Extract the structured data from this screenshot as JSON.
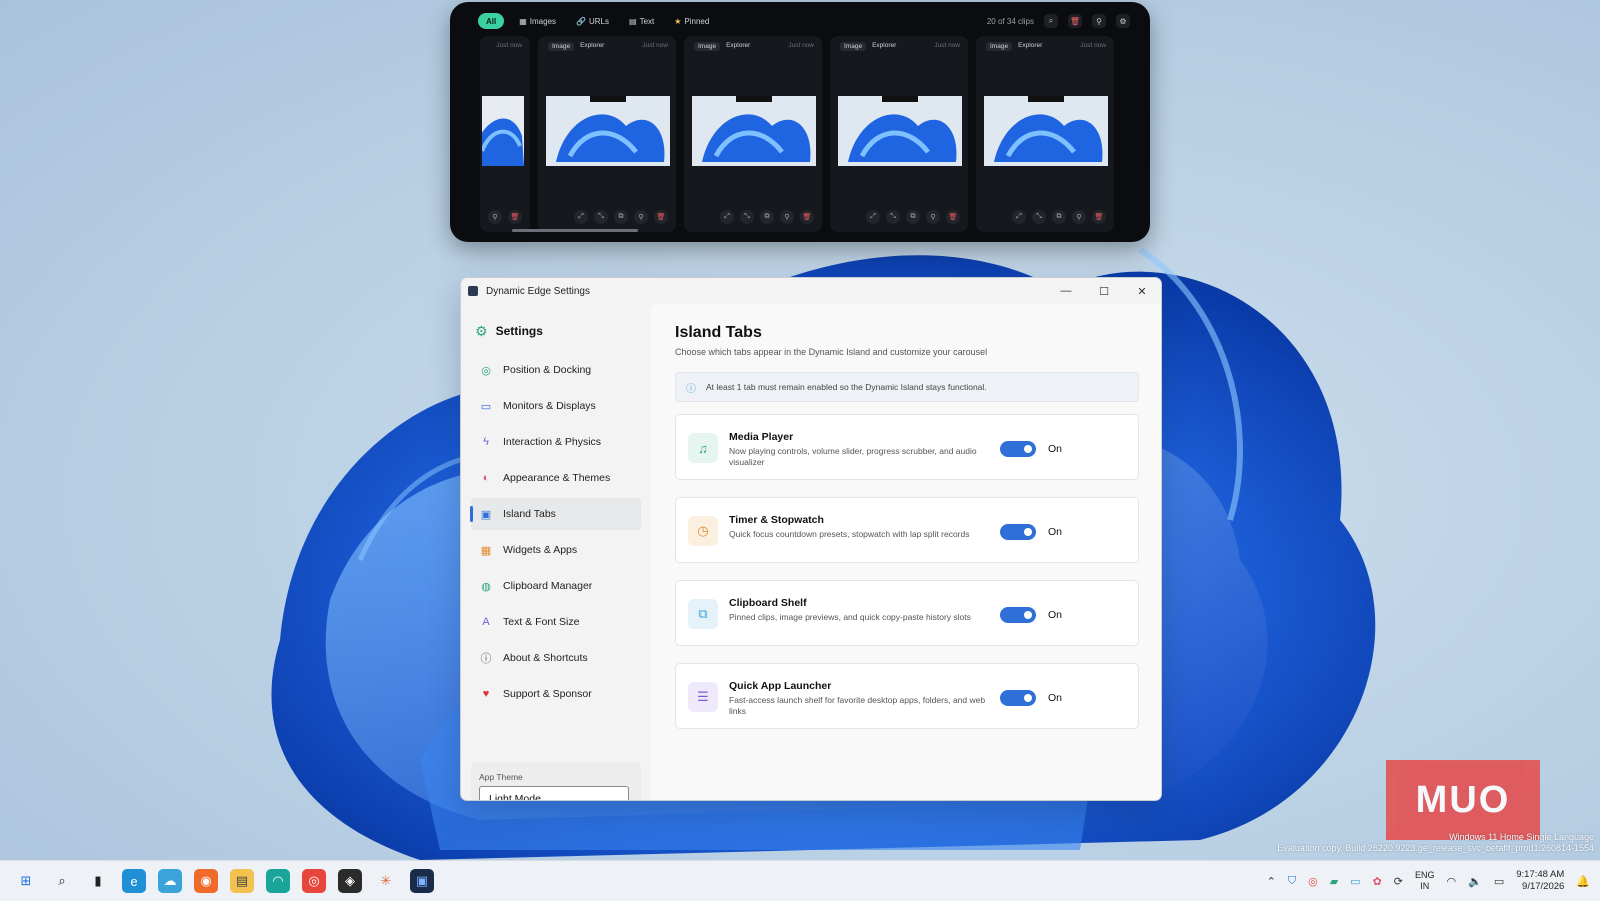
{
  "island": {
    "filters": [
      {
        "label": "All",
        "icon": "",
        "active": true
      },
      {
        "label": "Images",
        "icon": "▦",
        "active": false
      },
      {
        "label": "URLs",
        "icon": "🔗",
        "active": false
      },
      {
        "label": "Text",
        "icon": "▤",
        "active": false
      },
      {
        "label": "Pinned",
        "icon": "★",
        "active": false
      }
    ],
    "clip_count": "20 of 34 clips",
    "cards": [
      {
        "tag": "Image",
        "source": "Explorer",
        "time": "Just now"
      },
      {
        "tag": "Image",
        "source": "Explorer",
        "time": "Just now"
      },
      {
        "tag": "Image",
        "source": "Explorer",
        "time": "Just now"
      },
      {
        "tag": "Image",
        "source": "Explorer",
        "time": "Just now"
      }
    ],
    "partial_time": "Just now"
  },
  "window": {
    "title": "Dynamic Edge Settings",
    "controls": {
      "minimize": "—",
      "maximize": "☐",
      "close": "✕"
    }
  },
  "sidebar": {
    "title": "Settings",
    "items": [
      {
        "label": "Position & Docking",
        "icon": "◎",
        "color": "#2ba57a"
      },
      {
        "label": "Monitors & Displays",
        "icon": "▭",
        "color": "#2f6fd8"
      },
      {
        "label": "Interaction & Physics",
        "icon": "ϟ",
        "color": "#7b5cd6"
      },
      {
        "label": "Appearance & Themes",
        "icon": "◐",
        "color": "#e0556a"
      },
      {
        "label": "Island Tabs",
        "icon": "▣",
        "color": "#2f6fd8"
      },
      {
        "label": "Widgets & Apps",
        "icon": "▦",
        "color": "#e08a2b"
      },
      {
        "label": "Clipboard Manager",
        "icon": "◍",
        "color": "#2ba57a"
      },
      {
        "label": "Text & Font Size",
        "icon": "A",
        "color": "#7b5cd6"
      },
      {
        "label": "About & Shortcuts",
        "icon": "ⓘ",
        "color": "#555555"
      },
      {
        "label": "Support & Sponsor",
        "icon": "♥",
        "color": "#e0333f"
      }
    ],
    "active_index": 4,
    "theme": {
      "label": "App Theme",
      "value": "Light Mode"
    }
  },
  "main": {
    "title": "Island Tabs",
    "subtitle": "Choose which tabs appear in the Dynamic Island and customize your carousel",
    "info": "At least 1 tab must remain enabled so the Dynamic Island stays functional.",
    "tabs": [
      {
        "name": "Media Player",
        "desc": "Now playing controls, volume slider, progress scrubber, and audio visualizer",
        "state": "On",
        "icon": "♫",
        "icon_color": "#2ba57a",
        "icon_bg": "#e6f5ef"
      },
      {
        "name": "Timer & Stopwatch",
        "desc": "Quick focus countdown presets, stopwatch with lap split records",
        "state": "On",
        "icon": "◷",
        "icon_color": "#e08a2b",
        "icon_bg": "#fbefe0"
      },
      {
        "name": "Clipboard Shelf",
        "desc": "Pinned clips, image previews, and quick copy-paste history slots",
        "state": "On",
        "icon": "⧉",
        "icon_color": "#3aa3d9",
        "icon_bg": "#e5f2fa"
      },
      {
        "name": "Quick App Launcher",
        "desc": "Fast-access launch shelf for favorite desktop apps, folders, and web links",
        "state": "On",
        "icon": "☰",
        "icon_color": "#7b5cd6",
        "icon_bg": "#efeafb"
      }
    ]
  },
  "watermark": {
    "logo": "MUO",
    "line1": "Windows 11 Home Single Language",
    "line2": "Evaluation copy. Build 26220.9223.ge_release_svc_betaflt_prod1.260814-1554"
  },
  "taskbar": {
    "apps": [
      {
        "name": "start",
        "glyph": "⊞",
        "bg": "#eef2f6",
        "fg": "#1e73d9"
      },
      {
        "name": "search",
        "glyph": "⌕",
        "bg": "#eef2f6",
        "fg": "#222"
      },
      {
        "name": "task-view",
        "glyph": "▮",
        "bg": "#eef2f6",
        "fg": "#222"
      },
      {
        "name": "edge",
        "glyph": "e",
        "bg": "#1f8fd6",
        "fg": "#fff"
      },
      {
        "name": "weather",
        "glyph": "☁",
        "bg": "#3aa3d9",
        "fg": "#fff"
      },
      {
        "name": "firefox",
        "glyph": "◉",
        "bg": "#f06a2b",
        "fg": "#fff"
      },
      {
        "name": "file-explorer",
        "glyph": "▤",
        "bg": "#f2c14e",
        "fg": "#444"
      },
      {
        "name": "copilot",
        "glyph": "◠",
        "bg": "#1aa59a",
        "fg": "#fff"
      },
      {
        "name": "chrome",
        "glyph": "◎",
        "bg": "#e8453c",
        "fg": "#fff"
      },
      {
        "name": "github",
        "glyph": "◈",
        "bg": "#2b2b2b",
        "fg": "#fff"
      },
      {
        "name": "claude",
        "glyph": "✳",
        "bg": "#eef2f6",
        "fg": "#d9663a"
      },
      {
        "name": "dynamic-edge",
        "glyph": "▣",
        "bg": "#1a2c4a",
        "fg": "#7fb3ff"
      }
    ],
    "language": [
      "ENG",
      "IN"
    ],
    "time": "9:17:48 AM",
    "date": "9/17/2026"
  }
}
